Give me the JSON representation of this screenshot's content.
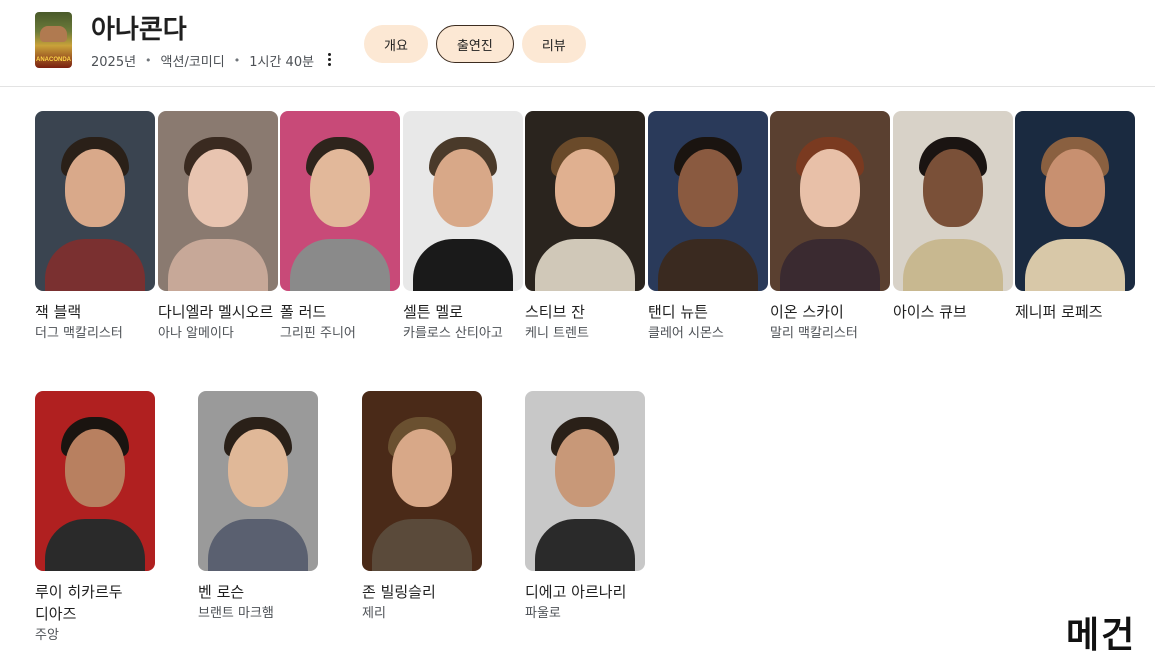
{
  "movie": {
    "title": "아나콘다",
    "year": "2025년",
    "genre": "액션/코미디",
    "runtime": "1시간 40분",
    "poster_text": "ANACONDA",
    "meta_separator": "•"
  },
  "tabs": [
    {
      "label": "개요",
      "active": false
    },
    {
      "label": "출연진",
      "active": true
    },
    {
      "label": "리뷰",
      "active": false
    }
  ],
  "cast": [
    {
      "name": "잭 블랙",
      "role": "더그 맥칼리스터",
      "bg": "#3a4450",
      "skin": "#d9a98a",
      "hair": "#2a2018",
      "cloth": "#7a3030"
    },
    {
      "name": "다니엘라 멜시오르",
      "role": "아나 알메이다",
      "bg": "#8a7a70",
      "skin": "#e8c4b0",
      "hair": "#3a2a20",
      "cloth": "#c7a898"
    },
    {
      "name": "폴 러드",
      "role": "그리핀 주니어",
      "bg": "#c84a78",
      "skin": "#e2b89a",
      "hair": "#2e241c",
      "cloth": "#8a8a8a"
    },
    {
      "name": "셀튼 멜로",
      "role": "카를로스 산티아고",
      "bg": "#e8e8e8",
      "skin": "#d8a888",
      "hair": "#4a3a2a",
      "cloth": "#1a1a1a"
    },
    {
      "name": "스티브 잔",
      "role": "케니 트렌트",
      "bg": "#2a241e",
      "skin": "#e0b090",
      "hair": "#6a4a2a",
      "cloth": "#d0c8b8"
    },
    {
      "name": "탠디 뉴튼",
      "role": "클레어 시몬스",
      "bg": "#2a3a5a",
      "skin": "#8a5a40",
      "hair": "#1a1410",
      "cloth": "#3a2a20"
    },
    {
      "name": "이온 스카이",
      "role": "말리 맥칼리스터",
      "bg": "#5a4030",
      "skin": "#e8c0a8",
      "hair": "#7a3a20",
      "cloth": "#3a2a30"
    },
    {
      "name": "아이스 큐브",
      "role": "",
      "bg": "#d8d2c8",
      "skin": "#7a5038",
      "hair": "#1a1412",
      "cloth": "#c8b890"
    },
    {
      "name": "제니퍼 로페즈",
      "role": "",
      "bg": "#1a2a40",
      "skin": "#c89070",
      "hair": "#8a6040",
      "cloth": "#d8c8a8"
    },
    {
      "name": "루이 히카르두 디아즈",
      "role": "주앙",
      "bg": "#b02020",
      "skin": "#b88060",
      "hair": "#1a1410",
      "cloth": "#2a2a2a"
    },
    {
      "name": "벤 로슨",
      "role": "브랜트 마크햄",
      "bg": "#9a9a9a",
      "skin": "#e0b898",
      "hair": "#2a2018",
      "cloth": "#5a6070"
    },
    {
      "name": "존 빌링슬리",
      "role": "제리",
      "bg": "#4a2a18",
      "skin": "#d8a888",
      "hair": "#6a5030",
      "cloth": "#5a4a3a"
    },
    {
      "name": "디에고 아르나리",
      "role": "파울로",
      "bg": "#c8c8c8",
      "skin": "#c89878",
      "hair": "#2a2018",
      "cloth": "#2a2a2a"
    }
  ],
  "watermark": "메건"
}
